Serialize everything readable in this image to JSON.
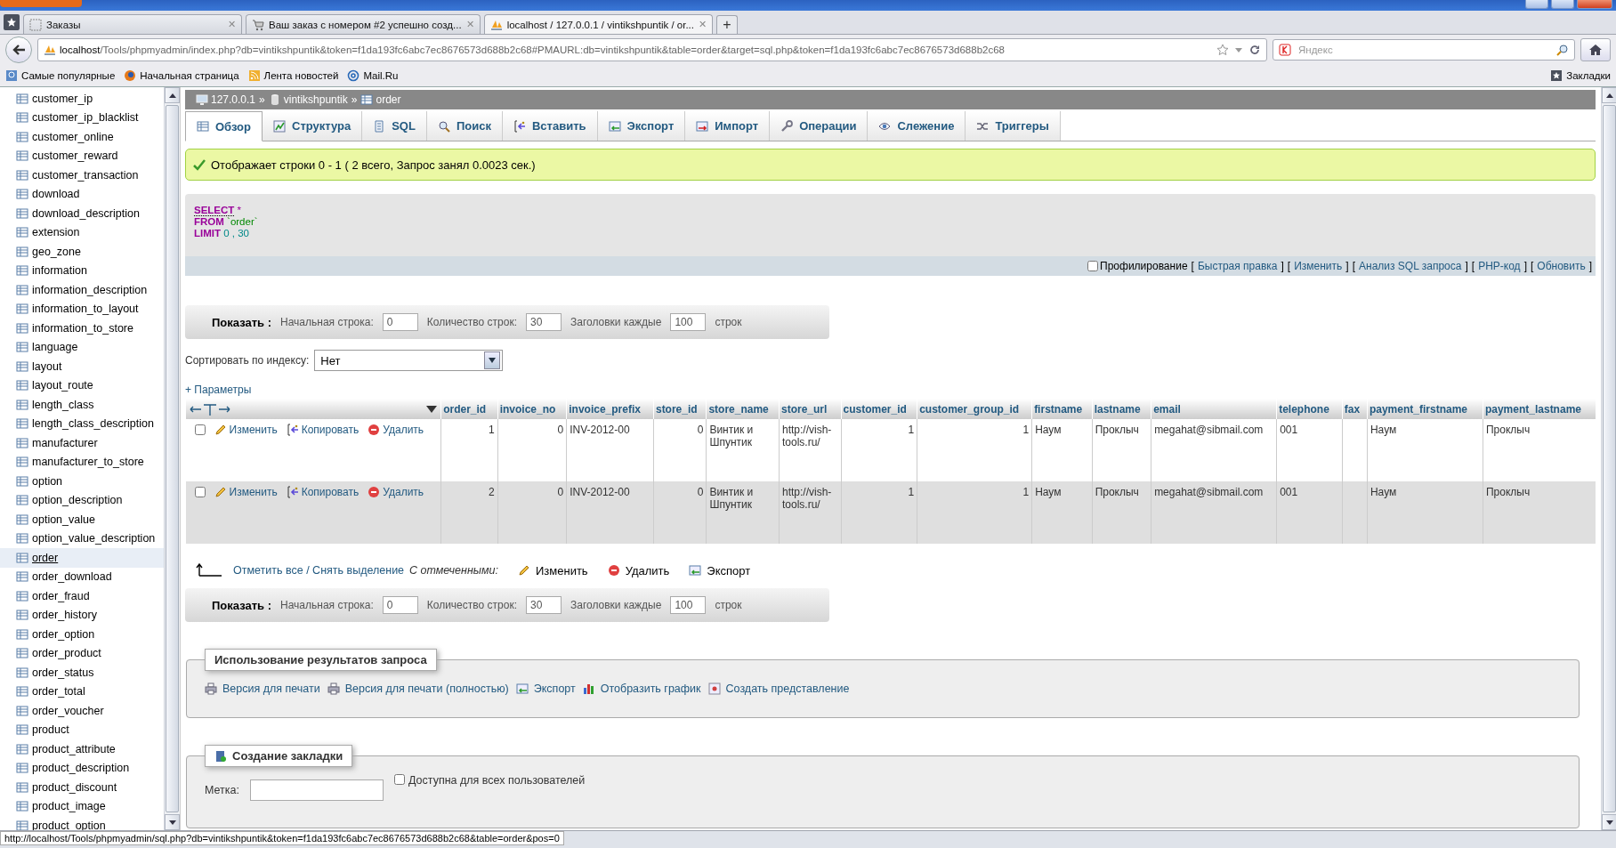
{
  "browser": {
    "tabs": [
      {
        "title": "Заказы",
        "kind": "blank",
        "selected": false,
        "close": "✕"
      },
      {
        "title": "Ваш заказ с номером #2 успешно созд...",
        "kind": "cart",
        "selected": false,
        "close": "✕"
      },
      {
        "title": "localhost / 127.0.0.1 / vintikshpuntik / or...",
        "kind": "pma",
        "selected": true,
        "close": "✕"
      }
    ],
    "new_tab": "+",
    "url_host": "localhost",
    "url_rest": "/Tools/phpmyadmin/index.php?db=vintikshpuntik&token=f1da193fc6abc7ec8676573d688b2c68#PMAURL:db=vintikshpuntik&table=order&target=sql.php&token=f1da193fc6abc7ec8676573d688b2c68",
    "search_placeholder": "Яндекс",
    "bookmarks": [
      {
        "label": "Самые популярные",
        "kind": "search"
      },
      {
        "label": "Начальная страница",
        "kind": "firefox"
      },
      {
        "label": "Лента новостей",
        "kind": "rss"
      },
      {
        "label": "Mail.Ru",
        "kind": "at"
      }
    ],
    "bookmarks_menu": "Закладки"
  },
  "sidebar": {
    "items": [
      {
        "label": "customer_ip",
        "selected": false
      },
      {
        "label": "customer_ip_blacklist",
        "selected": false
      },
      {
        "label": "customer_online",
        "selected": false
      },
      {
        "label": "customer_reward",
        "selected": false
      },
      {
        "label": "customer_transaction",
        "selected": false
      },
      {
        "label": "download",
        "selected": false
      },
      {
        "label": "download_description",
        "selected": false
      },
      {
        "label": "extension",
        "selected": false
      },
      {
        "label": "geo_zone",
        "selected": false
      },
      {
        "label": "information",
        "selected": false
      },
      {
        "label": "information_description",
        "selected": false
      },
      {
        "label": "information_to_layout",
        "selected": false
      },
      {
        "label": "information_to_store",
        "selected": false
      },
      {
        "label": "language",
        "selected": false
      },
      {
        "label": "layout",
        "selected": false
      },
      {
        "label": "layout_route",
        "selected": false
      },
      {
        "label": "length_class",
        "selected": false
      },
      {
        "label": "length_class_description",
        "selected": false
      },
      {
        "label": "manufacturer",
        "selected": false
      },
      {
        "label": "manufacturer_to_store",
        "selected": false
      },
      {
        "label": "option",
        "selected": false
      },
      {
        "label": "option_description",
        "selected": false
      },
      {
        "label": "option_value",
        "selected": false
      },
      {
        "label": "option_value_description",
        "selected": false
      },
      {
        "label": "order",
        "selected": true
      },
      {
        "label": "order_download",
        "selected": false
      },
      {
        "label": "order_fraud",
        "selected": false
      },
      {
        "label": "order_history",
        "selected": false
      },
      {
        "label": "order_option",
        "selected": false
      },
      {
        "label": "order_product",
        "selected": false
      },
      {
        "label": "order_status",
        "selected": false
      },
      {
        "label": "order_total",
        "selected": false
      },
      {
        "label": "order_voucher",
        "selected": false
      },
      {
        "label": "product",
        "selected": false
      },
      {
        "label": "product_attribute",
        "selected": false
      },
      {
        "label": "product_description",
        "selected": false
      },
      {
        "label": "product_discount",
        "selected": false
      },
      {
        "label": "product_image",
        "selected": false
      },
      {
        "label": "product_option",
        "selected": false
      }
    ]
  },
  "breadcrumb": [
    {
      "label": "127.0.0.1",
      "kind": "server",
      "separator": "»"
    },
    {
      "label": "vintikshpuntik",
      "kind": "database",
      "separator": "»"
    },
    {
      "label": "order",
      "kind": "table"
    }
  ],
  "tabs": [
    {
      "label": "Обзор",
      "kind": "browse",
      "selected": true
    },
    {
      "label": "Структура",
      "kind": "structure",
      "selected": false
    },
    {
      "label": "SQL",
      "kind": "sql",
      "selected": false
    },
    {
      "label": "Поиск",
      "kind": "search",
      "selected": false
    },
    {
      "label": "Вставить",
      "kind": "insert",
      "selected": false
    },
    {
      "label": "Экспорт",
      "kind": "export",
      "selected": false
    },
    {
      "label": "Импорт",
      "kind": "import",
      "selected": false
    },
    {
      "label": "Операции",
      "kind": "operations",
      "selected": false
    },
    {
      "label": "Слежение",
      "kind": "tracking",
      "selected": false
    },
    {
      "label": "Триггеры",
      "kind": "triggers",
      "selected": false
    }
  ],
  "message": "Отображает строки 0 - 1 ( 2 всего, Запрос занял 0.0023 сек.)",
  "sql": [
    {
      "keyword": "SELECT",
      "args": "*",
      "kind": "operator"
    },
    {
      "keyword": "FROM",
      "args": "`order`",
      "kind": "identifier"
    },
    {
      "keyword": "LIMIT",
      "args": "0 , 30",
      "kind": "number"
    }
  ],
  "sql_actions": {
    "profiling": {
      "label": "Профилирование",
      "checked": false
    },
    "links": [
      {
        "open": "[",
        "label": "Быстрая правка",
        "close": "]"
      },
      {
        "open": "[",
        "label": "Изменить",
        "close": "]"
      },
      {
        "open": "[",
        "label": "Анализ SQL запроса",
        "close": "]"
      },
      {
        "open": "[",
        "label": "PHP-код",
        "close": "]"
      },
      {
        "open": "[",
        "label": "Обновить",
        "close": "]"
      }
    ]
  },
  "navigation": [
    {
      "title": "Показать :",
      "fields": [
        {
          "label": "Начальная строка:",
          "value": "0"
        },
        {
          "label": "Количество строк:",
          "value": "30"
        },
        {
          "label": "Заголовки каждые",
          "value": "100"
        }
      ],
      "suffix": "строк"
    },
    {
      "title": "Показать :",
      "fields": [
        {
          "label": "Начальная строка:",
          "value": "0"
        },
        {
          "label": "Количество строк:",
          "value": "30"
        },
        {
          "label": "Заголовки каждые",
          "value": "100"
        }
      ],
      "suffix": "строк"
    }
  ],
  "sort": {
    "label": "Сортировать по индексу:",
    "value": "Нет"
  },
  "options_link": "+ Параметры",
  "table": {
    "columns": [
      {
        "name": "order_id",
        "numeric": true
      },
      {
        "name": "invoice_no",
        "numeric": true
      },
      {
        "name": "invoice_prefix",
        "numeric": false
      },
      {
        "name": "store_id",
        "numeric": true
      },
      {
        "name": "store_name",
        "numeric": false
      },
      {
        "name": "store_url",
        "numeric": false
      },
      {
        "name": "customer_id",
        "numeric": true
      },
      {
        "name": "customer_group_id",
        "numeric": true
      },
      {
        "name": "firstname",
        "numeric": false
      },
      {
        "name": "lastname",
        "numeric": false
      },
      {
        "name": "email",
        "numeric": false
      },
      {
        "name": "telephone",
        "numeric": false
      },
      {
        "name": "fax"
      },
      {
        "name": "payment_firstname",
        "numeric": false
      },
      {
        "name": "payment_lastname",
        "numeric": false
      }
    ],
    "rows": [
      {
        "checked": false,
        "highlighted": false,
        "actions": [
          {
            "label": "Изменить",
            "kind": "edit"
          },
          {
            "label": "Копировать",
            "kind": "copy"
          },
          {
            "label": "Удалить",
            "kind": "delete"
          }
        ],
        "cells": [
          "1",
          "0",
          "INV-2012-00",
          "0",
          "Винтик и Шпунтик",
          "http://vish-tools.ru/",
          "1",
          "1",
          "Наум",
          "Проклыч",
          "megahat@sibmail.com",
          "001",
          "",
          "Наум",
          "Проклыч"
        ]
      },
      {
        "checked": false,
        "highlighted": true,
        "actions": [
          {
            "label": "Изменить",
            "kind": "edit"
          },
          {
            "label": "Копировать",
            "kind": "copy"
          },
          {
            "label": "Удалить",
            "kind": "delete"
          }
        ],
        "cells": [
          "2",
          "0",
          "INV-2012-00",
          "0",
          "Винтик и Шпунтик",
          "http://vish-tools.ru/",
          "1",
          "1",
          "Наум",
          "Проклыч",
          "megahat@sibmail.com",
          "001",
          "",
          "Наум",
          "Проклыч"
        ]
      }
    ]
  },
  "bulk": {
    "check_all": "Отметить все / Снять выделение",
    "with_selected": "С отмеченными:",
    "actions": [
      {
        "label": "Изменить",
        "kind": "edit"
      },
      {
        "label": "Удалить",
        "kind": "delete"
      },
      {
        "label": "Экспорт",
        "kind": "export"
      }
    ]
  },
  "query_results": {
    "legend": "Использование результатов запроса",
    "links": [
      {
        "label": "Версия для печати",
        "kind": "print"
      },
      {
        "label": "Версия для печати (полностью)",
        "kind": "print"
      },
      {
        "label": "Экспорт",
        "kind": "export"
      },
      {
        "label": "Отобразить график",
        "kind": "chart"
      },
      {
        "label": "Создать представление",
        "kind": "view"
      }
    ]
  },
  "bookmark": {
    "legend": "Создание закладки",
    "label_field": "Метка:",
    "public": {
      "label": "Доступна для всех пользователей",
      "checked": false
    }
  },
  "status_url": "http://localhost/Tools/phpmyadmin/sql.php?db=vintikshpuntik&token=f1da193fc6abc7ec8676573d688b2c68&table=order&pos=0"
}
